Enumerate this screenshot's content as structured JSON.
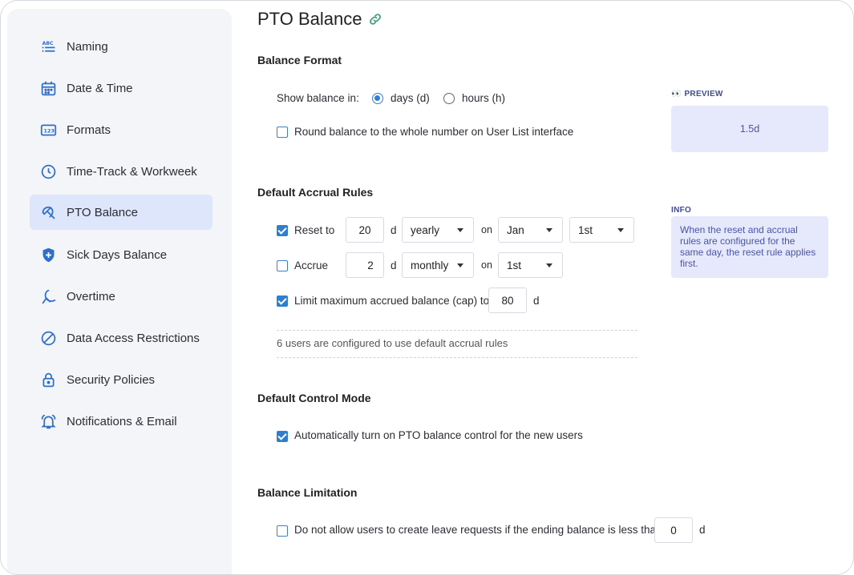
{
  "sidebar": {
    "items": [
      {
        "label": "Naming",
        "icon": "abc-list-icon",
        "active": false
      },
      {
        "label": "Date & Time",
        "icon": "calendar-icon",
        "active": false
      },
      {
        "label": "Formats",
        "icon": "number-format-icon",
        "active": false
      },
      {
        "label": "Time-Track & Workweek",
        "icon": "clock-icon",
        "active": false
      },
      {
        "label": "PTO Balance",
        "icon": "beach-umbrella-icon",
        "active": true
      },
      {
        "label": "Sick Days Balance",
        "icon": "medical-shield-icon",
        "active": false
      },
      {
        "label": "Overtime",
        "icon": "moon-person-icon",
        "active": false
      },
      {
        "label": "Data Access Restrictions",
        "icon": "prohibited-icon",
        "active": false
      },
      {
        "label": "Security Policies",
        "icon": "lock-icon",
        "active": false
      },
      {
        "label": "Notifications & Email",
        "icon": "bell-icon",
        "active": false
      }
    ]
  },
  "page": {
    "title": "PTO Balance",
    "link_icon": "link-icon"
  },
  "balance_format": {
    "title": "Balance Format",
    "show_label": "Show balance in:",
    "option_days": "days (d)",
    "option_hours": "hours (h)",
    "selected": "days",
    "round_label": "Round balance to the whole number on User List interface",
    "round_checked": false,
    "preview_label": "PREVIEW",
    "preview_emoji": "👀",
    "preview_value": "1.5d"
  },
  "accrual": {
    "title": "Default Accrual Rules",
    "reset_label": "Reset to",
    "reset_checked": true,
    "reset_value": "20",
    "reset_unit": "d",
    "reset_period": "yearly",
    "on_label": "on",
    "reset_month": "Jan",
    "reset_day": "1st",
    "accrue_label": "Accrue",
    "accrue_checked": false,
    "accrue_value": "2",
    "accrue_unit": "d",
    "accrue_period": "monthly",
    "accrue_day": "1st",
    "cap_label": "Limit maximum accrued balance (cap) to",
    "cap_checked": true,
    "cap_value": "80",
    "cap_unit": "d",
    "users_note": "6 users are configured to use default accrual rules",
    "info_label": "INFO",
    "info_text": "When the reset and accrual rules are configured for the same day, the reset rule applies first."
  },
  "control_mode": {
    "title": "Default Control Mode",
    "auto_label": "Automatically turn on PTO balance control for the new users",
    "auto_checked": true
  },
  "limitation": {
    "title": "Balance Limitation",
    "limit_label": "Do not allow users to create leave requests if the ending balance is less than",
    "limit_checked": false,
    "limit_value": "0",
    "limit_unit": "d"
  },
  "colors": {
    "accent": "#2f7fd0",
    "active_nav_bg": "#dde6fb",
    "panel_bg": "#e6e9fb"
  }
}
